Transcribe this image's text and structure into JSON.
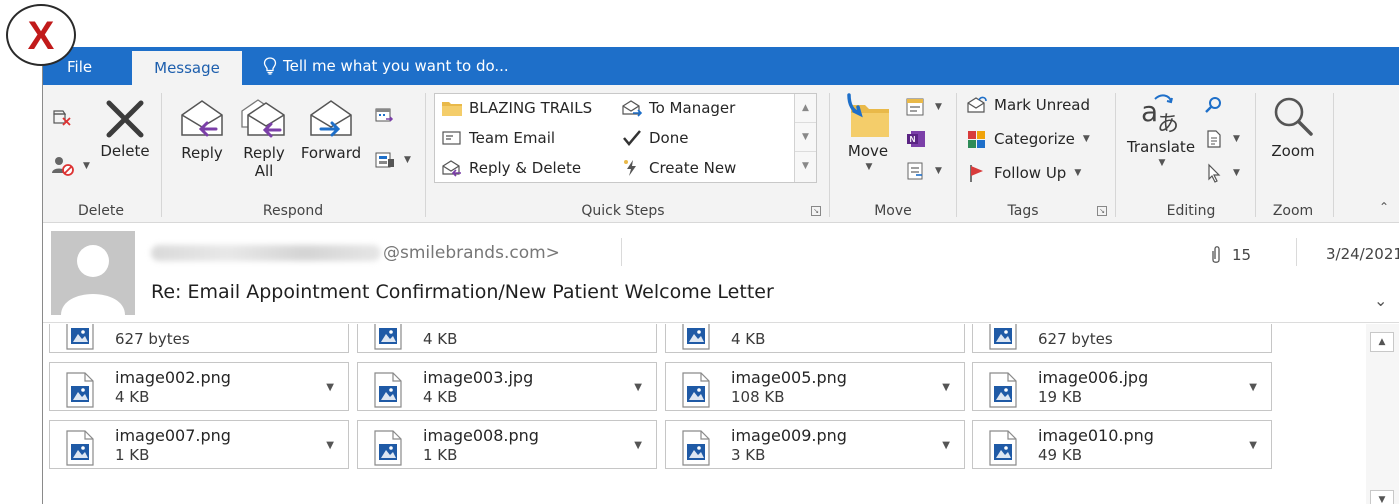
{
  "badge": {
    "letter": "X"
  },
  "tabs": {
    "file": "File",
    "message": "Message",
    "tell_me": "Tell me what you want to do..."
  },
  "ribbon": {
    "delete_group": {
      "label": "Delete",
      "delete_button": "Delete"
    },
    "respond_group": {
      "label": "Respond",
      "reply": "Reply",
      "reply_all_line1": "Reply",
      "reply_all_line2": "All",
      "forward": "Forward"
    },
    "quick_steps": {
      "label": "Quick Steps",
      "items": [
        "BLAZING TRAILS",
        "To Manager",
        "Team Email",
        "Done",
        "Reply & Delete",
        "Create New"
      ]
    },
    "move_group": {
      "label": "Move",
      "move_button": "Move"
    },
    "tags_group": {
      "label": "Tags",
      "mark_unread": "Mark Unread",
      "categorize": "Categorize",
      "follow_up": "Follow Up"
    },
    "editing_group": {
      "label": "Editing",
      "translate": "Translate"
    },
    "zoom_group": {
      "label": "Zoom",
      "zoom_button": "Zoom"
    }
  },
  "message_header": {
    "sender_visible": "@smilebrands.com>",
    "subject": "Re: Email Appointment Confirmation/New Patient Welcome Letter",
    "attachment_count": "15",
    "date": "3/24/2021"
  },
  "attachments": [
    {
      "name": "",
      "size": "627 bytes"
    },
    {
      "name": "",
      "size": "4 KB"
    },
    {
      "name": "",
      "size": "4 KB"
    },
    {
      "name": "",
      "size": "627 bytes"
    },
    {
      "name": "image002.png",
      "size": "4 KB"
    },
    {
      "name": "image003.jpg",
      "size": "4 KB"
    },
    {
      "name": "image005.png",
      "size": "108 KB"
    },
    {
      "name": "image006.jpg",
      "size": "19 KB"
    },
    {
      "name": "image007.png",
      "size": "1 KB"
    },
    {
      "name": "image008.png",
      "size": "1 KB"
    },
    {
      "name": "image009.png",
      "size": "3 KB"
    },
    {
      "name": "image010.png",
      "size": "49 KB"
    }
  ],
  "colors": {
    "accent": "#1e6fc9",
    "badge_red": "#c11a1a"
  }
}
